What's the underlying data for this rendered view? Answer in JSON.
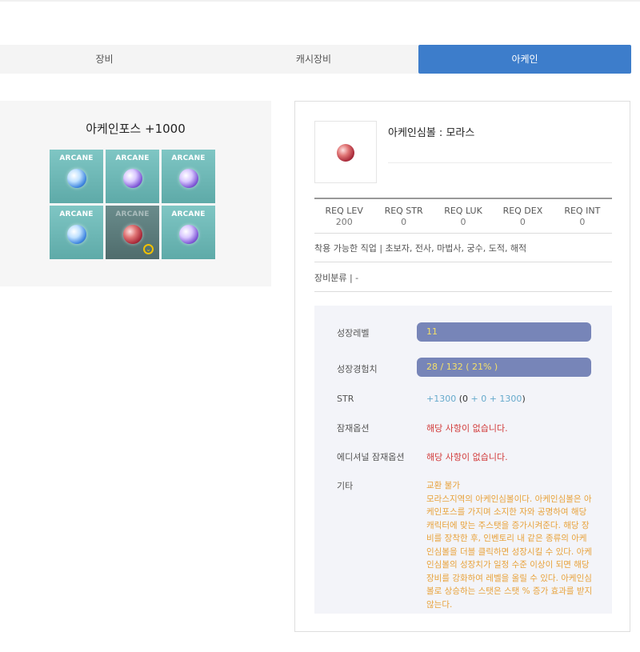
{
  "tabs": [
    {
      "label": "장비",
      "active": false
    },
    {
      "label": "캐시장비",
      "active": false
    },
    {
      "label": "아케인",
      "active": true
    }
  ],
  "arcane": {
    "title": "아케인포스 +1000",
    "cells": [
      {
        "label": "ARCANE",
        "orb": "blue-arcane-symbol-icon"
      },
      {
        "label": "ARCANE",
        "orb": "purple-arcane-symbol-icon"
      },
      {
        "label": "ARCANE",
        "orb": "purple-arcane-symbol-icon"
      },
      {
        "label": "ARCANE",
        "orb": "blue-arcane-symbol-icon"
      },
      {
        "label": "ARCANE",
        "orb": "red-arcane-symbol-icon",
        "selected": true
      },
      {
        "label": "ARCANE",
        "orb": "purple-arcane-symbol-icon"
      }
    ]
  },
  "item": {
    "name": "아케인심볼 : 모라스",
    "req": [
      {
        "label": "REQ LEV",
        "value": "200"
      },
      {
        "label": "REQ STR",
        "value": "0"
      },
      {
        "label": "REQ LUK",
        "value": "0"
      },
      {
        "label": "REQ DEX",
        "value": "0"
      },
      {
        "label": "REQ INT",
        "value": "0"
      }
    ],
    "jobs_line": "착용 가능한 직업 | 초보자, 전사, 마법사, 궁수, 도적, 해적",
    "category_line": "장비분류 | -"
  },
  "stats": {
    "growth_level_label": "성장레벨",
    "growth_level_value": "11",
    "growth_exp_label": "성장경험치",
    "growth_exp_value": "28 / 132 ( 21% )",
    "str_label": "STR",
    "str_total": "+1300",
    "str_open": " (",
    "str_base": "0",
    "str_plus1": " + 0 + 1300",
    "str_close": ")",
    "potential_label": "잠재옵션",
    "potential_value": "해당 사항이 없습니다.",
    "additional_label": "에디셔널 잠재옵션",
    "additional_value": "해당 사항이 없습니다.",
    "etc_label": "기타",
    "etc_value": "교환 불가\n모라스지역의 아케인심볼이다. 아케인심볼은 아케인포스를 가지며 소지한 자와 공명하여 해당 캐릭터에 맞는 주스탯을 증가시켜준다. 해당 장비를 장착한 후, 인벤토리 내 같은 종류의 아케인심볼을 더블 클릭하면 성장시킬 수 있다. 아케인심볼의 성장치가 일정 수준 이상이 되면 해당 장비를 강화하여 레벨을 올릴 수 있다. 아케인심볼로 상승하는 스탯은 스탯 % 증가 효과를 받지 않는다."
  },
  "colors": {
    "active_tab": "#3d7dcb",
    "bar": "#7785b8",
    "bar_text": "#f3e06a",
    "notice_red": "#d23b3b",
    "etc_text": "#e8a23b",
    "str_bonus": "#66aacc"
  }
}
